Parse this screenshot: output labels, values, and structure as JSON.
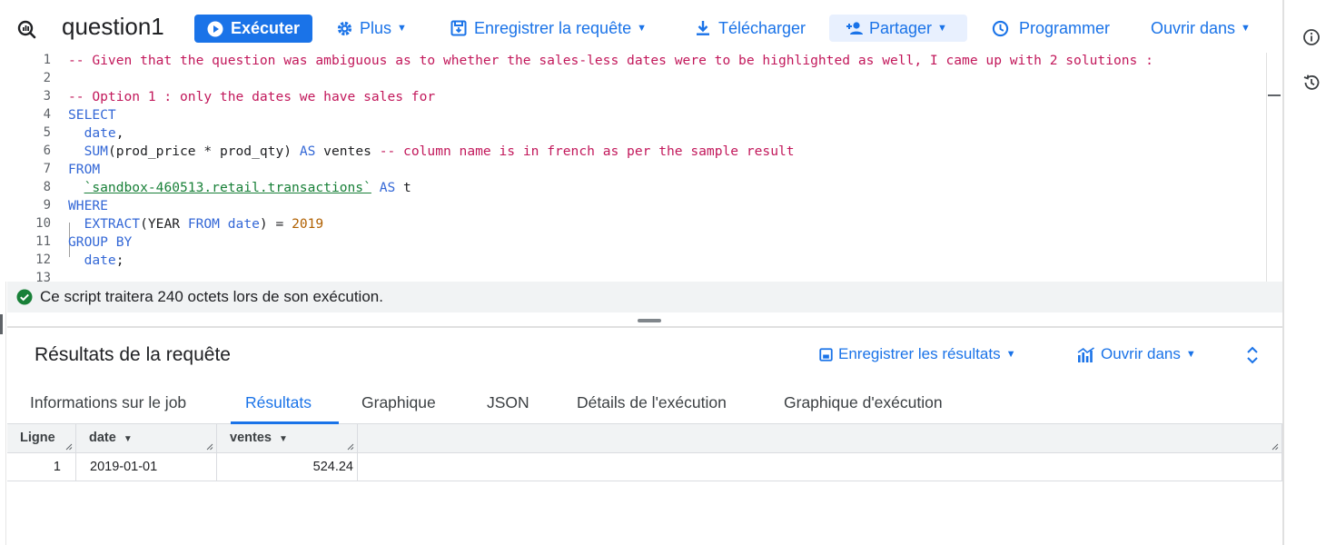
{
  "toolbar": {
    "title": "question1",
    "run_label": "Exécuter",
    "more_label": "Plus",
    "save_query_label": "Enregistrer la requête",
    "download_label": "Télécharger",
    "share_label": "Partager",
    "schedule_label": "Programmer",
    "open_in_label": "Ouvrir dans"
  },
  "editor": {
    "line_numbers": [
      "1",
      "2",
      "3",
      "4",
      "5",
      "6",
      "7",
      "8",
      "9",
      "10",
      "11",
      "12",
      "13"
    ],
    "lines": [
      [
        {
          "t": "-- Given that the question was ambiguous as to whether the sales-less dates were to be highlighted as well, I came up with 2 solutions :",
          "c": "comment"
        }
      ],
      [],
      [
        {
          "t": "-- Option 1 : only the dates we have sales for",
          "c": "comment"
        }
      ],
      [
        {
          "t": "SELECT",
          "c": "kw"
        }
      ],
      [
        {
          "t": "  "
        },
        {
          "t": "date",
          "c": "kw"
        },
        {
          "t": ","
        }
      ],
      [
        {
          "t": "  "
        },
        {
          "t": "SUM",
          "c": "kw"
        },
        {
          "t": "(prod_price * prod_qty) "
        },
        {
          "t": "AS",
          "c": "kw"
        },
        {
          "t": " ventes "
        },
        {
          "t": "-- column name is in french as per the sample result",
          "c": "comment"
        }
      ],
      [
        {
          "t": "FROM",
          "c": "kw"
        }
      ],
      [
        {
          "t": "  "
        },
        {
          "t": "`sandbox-460513.retail.transactions`",
          "c": "str"
        },
        {
          "t": " "
        },
        {
          "t": "AS",
          "c": "kw"
        },
        {
          "t": " t"
        }
      ],
      [
        {
          "t": "WHERE",
          "c": "kw"
        }
      ],
      [
        {
          "t": "  "
        },
        {
          "t": "EXTRACT",
          "c": "kw"
        },
        {
          "t": "(YEAR "
        },
        {
          "t": "FROM",
          "c": "kw"
        },
        {
          "t": " "
        },
        {
          "t": "date",
          "c": "kw"
        },
        {
          "t": ") = "
        },
        {
          "t": "2019",
          "c": "num"
        }
      ],
      [
        {
          "t": "GROUP BY",
          "c": "kw"
        }
      ],
      [
        {
          "t": "  "
        },
        {
          "t": "date",
          "c": "kw"
        },
        {
          "t": ";"
        }
      ],
      []
    ]
  },
  "status": {
    "message": "Ce script traitera 240 octets lors de son exécution."
  },
  "results": {
    "title": "Résultats de la requête",
    "save_results_label": "Enregistrer les résultats",
    "open_in_label": "Ouvrir dans",
    "tabs": [
      "Informations sur le job",
      "Résultats",
      "Graphique",
      "JSON",
      "Détails de l'exécution",
      "Graphique d'exécution"
    ],
    "active_tab": "Résultats",
    "columns": [
      "Ligne",
      "date",
      "ventes"
    ],
    "rows": [
      {
        "row": "1",
        "date": "2019-01-01",
        "ventes": "524.24"
      }
    ]
  },
  "colors": {
    "accent": "#1a73e8",
    "comment": "#c2185b",
    "keyword": "#3367d6",
    "string": "#188038",
    "number": "#b06000",
    "success": "#188038"
  }
}
